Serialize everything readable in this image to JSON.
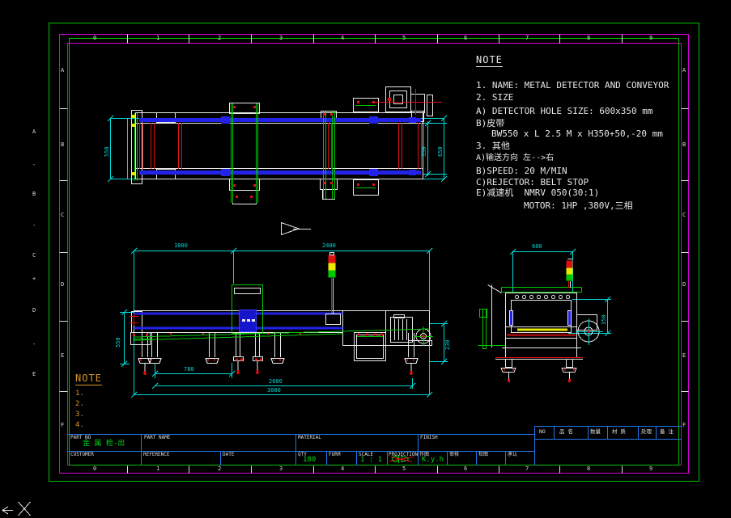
{
  "colors": {
    "background": "#000000",
    "frame_green": "#00c000",
    "band_magenta": "#d400d4",
    "dim_cyan": "#00d8d8",
    "geometry_white": "#e8e8e8",
    "geometry_blue": "#2222e8",
    "geometry_green": "#00c800",
    "geometry_red": "#e01010",
    "geometry_yellow": "#e8e800",
    "title_block_blue": "#2277ee",
    "note_orange": "#d79628",
    "value_green": "#00d818"
  },
  "zones": {
    "top_numbers": [
      "0",
      "1",
      "2",
      "3",
      "4",
      "5",
      "6",
      "7",
      "8",
      "9"
    ],
    "bottom_numbers": [
      "0",
      "1",
      "2",
      "3",
      "4",
      "5",
      "6",
      "7",
      "8",
      "9"
    ],
    "left_letters": [
      "A",
      "B",
      "C",
      "D",
      "E",
      "F"
    ],
    "right_letters": [
      "A",
      "B",
      "C",
      "D",
      "E",
      "F"
    ]
  },
  "outer_ruler_marks": [
    "A",
    "-",
    "B",
    "-",
    "C",
    "+",
    "D",
    "-",
    "E"
  ],
  "note": {
    "title": "NOTE",
    "line1": "1. NAME: METAL DETECTOR AND CONVEYOR",
    "line2": "2. SIZE",
    "line3": "A) DETECTOR HOLE SIZE: 600x350 mm",
    "line4": "B)皮带",
    "line5": "BW550 x L 2.5 M x H350+50,-20 mm",
    "line6": "3. 其他",
    "line7": "A)输送方向 左-->右",
    "line8": "B)SPEED: 20 M/MIN",
    "line9": "C)REJECTOR: BELT STOP",
    "line10": "E)减速机  NMRV 050(30:1)",
    "line11": "MOTOR: 1HP ,380V,三相"
  },
  "note2": {
    "title": "NOTE",
    "item1": "1.",
    "item2": "2.",
    "item3": "3.",
    "item4": "4."
  },
  "dims": {
    "top_view": {
      "left": "550",
      "right_inner": "550",
      "right_outer": "650"
    },
    "front_view": {
      "span_left": "1000",
      "span_right": "2400",
      "height_left": "550",
      "height_right": "230",
      "bottom1": "780",
      "bottom2": "2600",
      "bottom3": "3000"
    },
    "side_view": {
      "width": "600",
      "height": "350"
    }
  },
  "title_block": {
    "part_no_label": "PART NO",
    "part_no_value": "金 属 检-出",
    "part_name_label": "PART NAME",
    "material_label": "MATERIAL",
    "finish_label": "FINISH",
    "customer_label": "CUSTOMER",
    "reference_label": "REFERENCE",
    "date_label": "DATE",
    "qty_label": "QTY",
    "qty_value": "180",
    "form_label": "FORM",
    "scale_label": "SCALE",
    "scale_value": "1 : 1",
    "projection_label": "PROJECTION",
    "projection_icon": "first-angle-projection-crossed-icon",
    "drawn_label": "作图",
    "drawn_value": "K.y.h",
    "check_label": "审核",
    "review_label": "检图",
    "approve_label": "承认",
    "parts_header": {
      "no": "NO",
      "name": "品 名",
      "qty": "数量",
      "material": "材 质",
      "treat": "处理",
      "remark": "备 注"
    }
  },
  "ucs": {
    "axis_label": "X"
  }
}
